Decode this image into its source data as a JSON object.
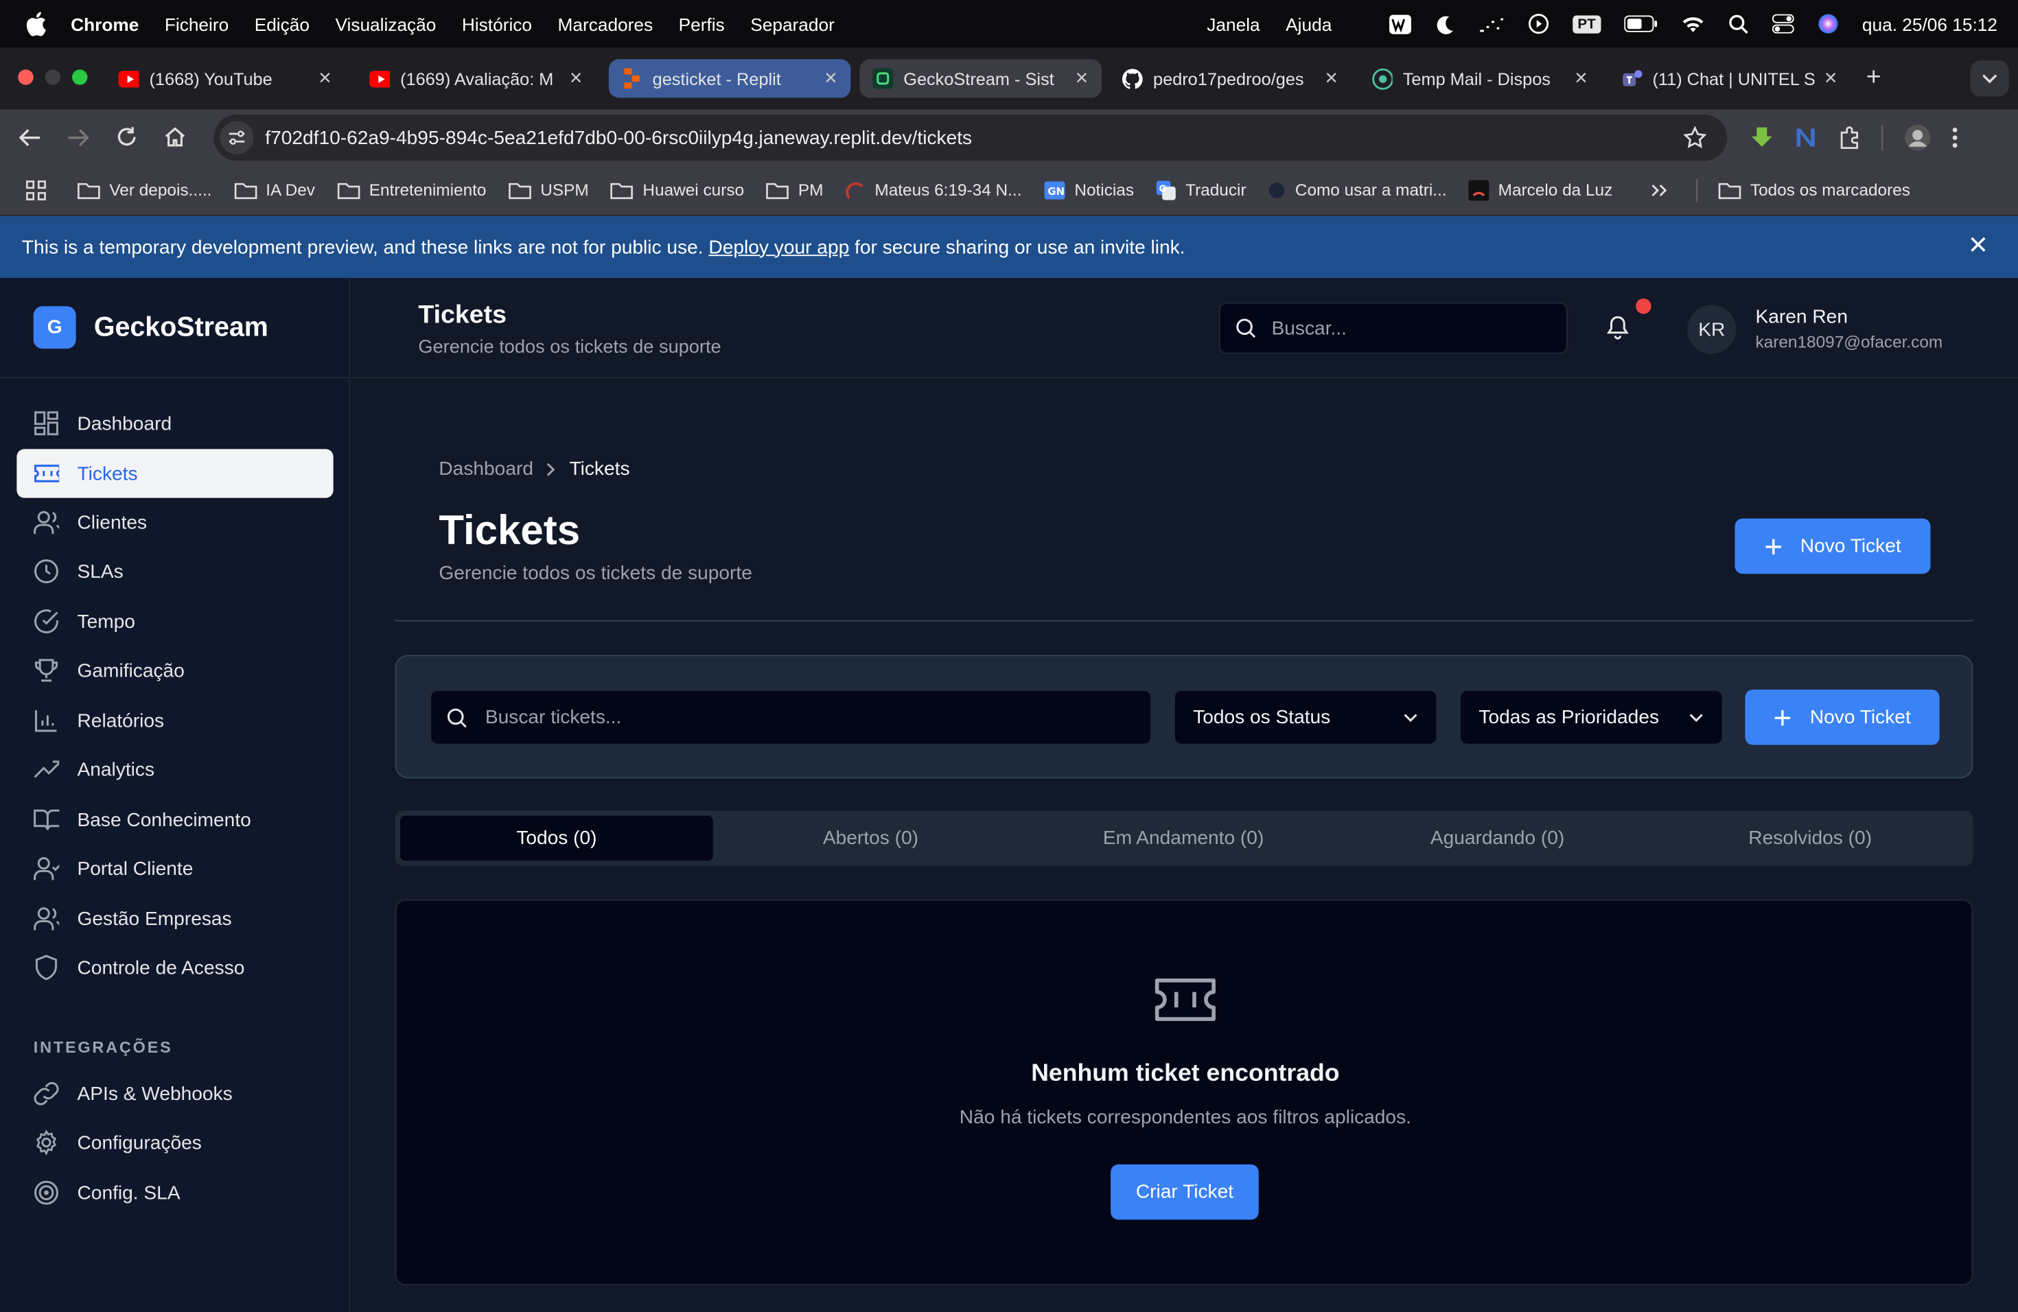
{
  "menubar": {
    "app": "Chrome",
    "items": [
      "Ficheiro",
      "Edição",
      "Visualização",
      "Histórico",
      "Marcadores",
      "Perfis",
      "Separador"
    ],
    "right_items": [
      "Janela",
      "Ajuda"
    ],
    "input_lang": "PT",
    "clock": "qua. 25/06  15:12"
  },
  "tabs": [
    {
      "title": "(1668) YouTube",
      "favicon": "youtube-icon",
      "color": "#ff0000"
    },
    {
      "title": "(1669) Avaliação: M",
      "favicon": "youtube-icon",
      "color": "#ff0000"
    },
    {
      "title": "gesticket - Replit",
      "favicon": "replit-icon",
      "color": "#f26207"
    },
    {
      "title": "GeckoStream - Sist",
      "favicon": "geckostream-icon",
      "color": "#22c55e"
    },
    {
      "title": "pedro17pedroo/ges",
      "favicon": "github-icon",
      "color": "#ffffff"
    },
    {
      "title": "Temp Mail - Dispos",
      "favicon": "tempmail-icon",
      "color": "#4cc2a4"
    },
    {
      "title": "(11) Chat | UNITEL S",
      "favicon": "teams-icon",
      "color": "#6264a7"
    }
  ],
  "address": {
    "url": "f702df10-62a9-4b95-894c-5ea21efd7db0-00-6rsc0iilyp4g.janeway.replit.dev/tickets"
  },
  "bookmarks": [
    {
      "label": "Ver depois.....",
      "icon": "folder-icon"
    },
    {
      "label": "IA Dev",
      "icon": "folder-icon"
    },
    {
      "label": "Entretenimiento",
      "icon": "folder-icon"
    },
    {
      "label": "USPM",
      "icon": "folder-icon"
    },
    {
      "label": "Huawei curso",
      "icon": "folder-icon"
    },
    {
      "label": "PM",
      "icon": "folder-icon"
    },
    {
      "label": "Mateus 6:19-34 N...",
      "icon": "bible-icon"
    },
    {
      "label": "Noticias",
      "icon": "news-icon"
    },
    {
      "label": "Traducir",
      "icon": "translate-icon"
    },
    {
      "label": "Como usar a matri...",
      "icon": "page-icon"
    },
    {
      "label": "Marcelo da Luz",
      "icon": "channel-icon"
    }
  ],
  "bookmarks_all": "Todos os marcadores",
  "banner": {
    "text_before": "This is a temporary development preview, and these links are not for public use.",
    "link": "Deploy your app",
    "text_after": "for secure sharing or use an invite link."
  },
  "brand": {
    "logo": "G",
    "name": "GeckoStream",
    "accent": "#3b82f6"
  },
  "sidebar": {
    "items": [
      {
        "label": "Dashboard",
        "icon": "dashboard-icon"
      },
      {
        "label": "Tickets",
        "icon": "ticket-icon",
        "active": true
      },
      {
        "label": "Clientes",
        "icon": "users-icon"
      },
      {
        "label": "SLAs",
        "icon": "clock-icon"
      },
      {
        "label": "Tempo",
        "icon": "check-circle-icon"
      },
      {
        "label": "Gamificação",
        "icon": "trophy-icon"
      },
      {
        "label": "Relatórios",
        "icon": "bar-chart-icon"
      },
      {
        "label": "Analytics",
        "icon": "trending-up-icon"
      },
      {
        "label": "Base Conhecimento",
        "icon": "book-icon"
      },
      {
        "label": "Portal Cliente",
        "icon": "user-check-icon"
      },
      {
        "label": "Gestão Empresas",
        "icon": "users-icon"
      },
      {
        "label": "Controle de Acesso",
        "icon": "shield-icon"
      }
    ],
    "section_title": "INTEGRAÇÕES",
    "integrations": [
      {
        "label": "APIs & Webhooks",
        "icon": "link-icon"
      },
      {
        "label": "Configurações",
        "icon": "gear-icon"
      },
      {
        "label": "Config. SLA",
        "icon": "target-icon"
      }
    ]
  },
  "header": {
    "title": "Tickets",
    "subtitle": "Gerencie todos os tickets de suporte",
    "search_placeholder": "Buscar...",
    "user": {
      "initials": "KR",
      "name": "Karen Ren",
      "email": "karen18097@ofacer.com"
    }
  },
  "main": {
    "breadcrumb": [
      "Dashboard",
      "Tickets"
    ],
    "title": "Tickets",
    "subtitle": "Gerencie todos os tickets de suporte",
    "new_ticket_label": "Novo Ticket",
    "filters": {
      "search_placeholder": "Buscar tickets...",
      "status": "Todos os Status",
      "priority": "Todas as Prioridades",
      "new_ticket_label": "Novo Ticket"
    },
    "tabs": [
      {
        "label": "Todos (0)",
        "active": true
      },
      {
        "label": "Abertos (0)"
      },
      {
        "label": "Em Andamento (0)"
      },
      {
        "label": "Aguardando (0)"
      },
      {
        "label": "Resolvidos (0)"
      }
    ],
    "empty": {
      "title": "Nenhum ticket encontrado",
      "subtitle": "Não há tickets correspondentes aos filtros aplicados.",
      "button": "Criar Ticket"
    }
  }
}
